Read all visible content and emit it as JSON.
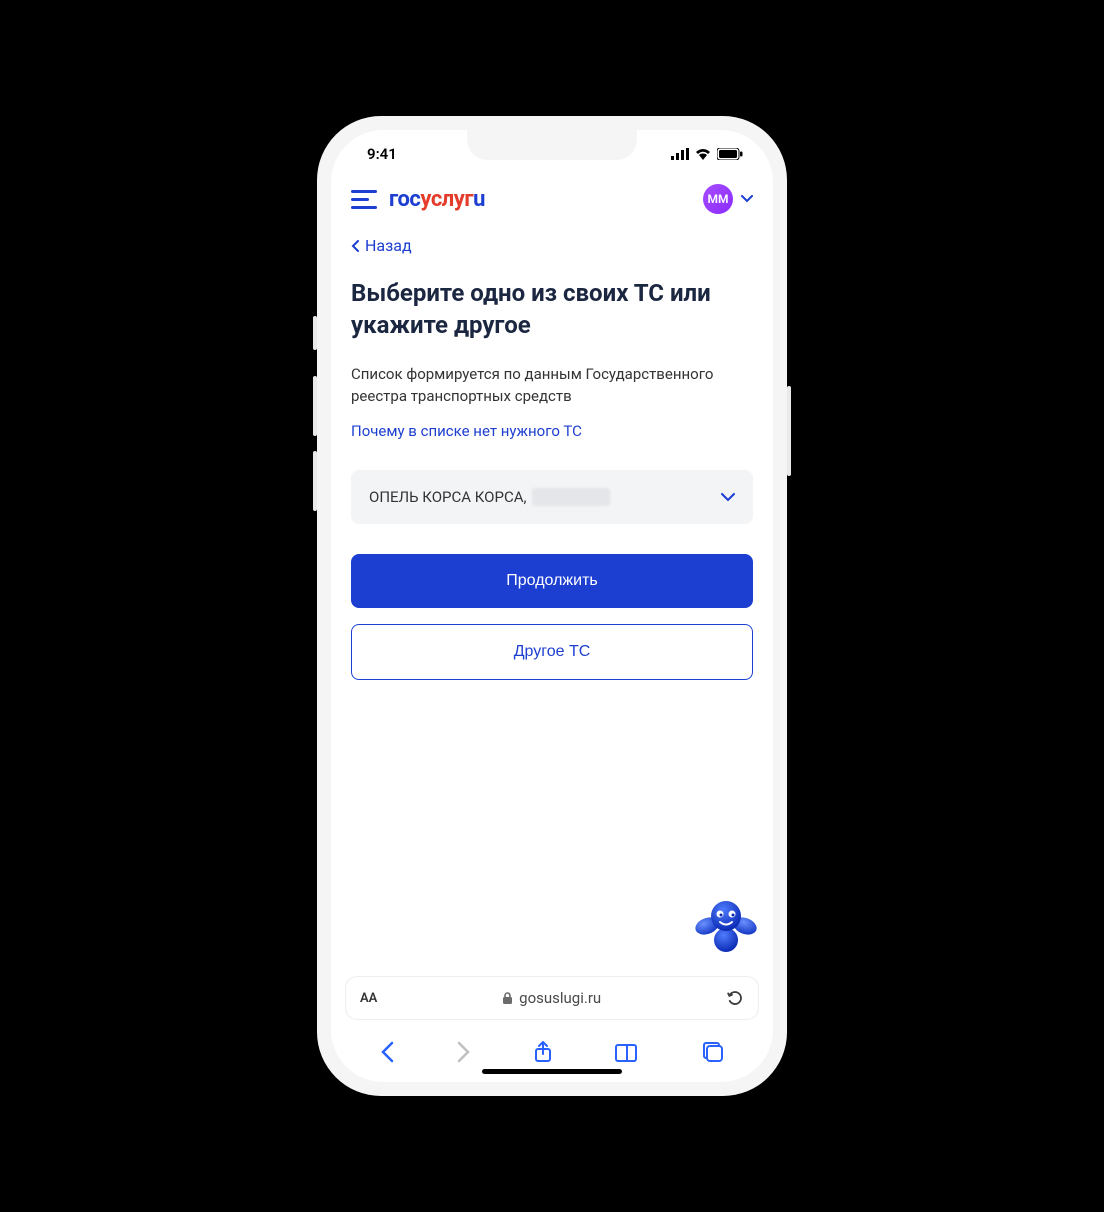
{
  "status": {
    "time": "9:41"
  },
  "header": {
    "logo_blue_1": "гос",
    "logo_red": "услуг",
    "logo_blue_2": "u",
    "avatar_initials": "ММ"
  },
  "nav": {
    "back_label": "Назад"
  },
  "page": {
    "title": "Выберите одно из своих ТС или укажите другое",
    "description": "Список формируется по данным Государственного реестра транспортных средств",
    "why_link": "Почему в списке нет нужного ТС"
  },
  "select": {
    "value_prefix": "ОПЕЛЬ КОРСА КОРСА,"
  },
  "buttons": {
    "continue": "Продолжить",
    "other": "Другое ТС"
  },
  "browser": {
    "aa": "AA",
    "domain": "gosuslugi.ru"
  }
}
